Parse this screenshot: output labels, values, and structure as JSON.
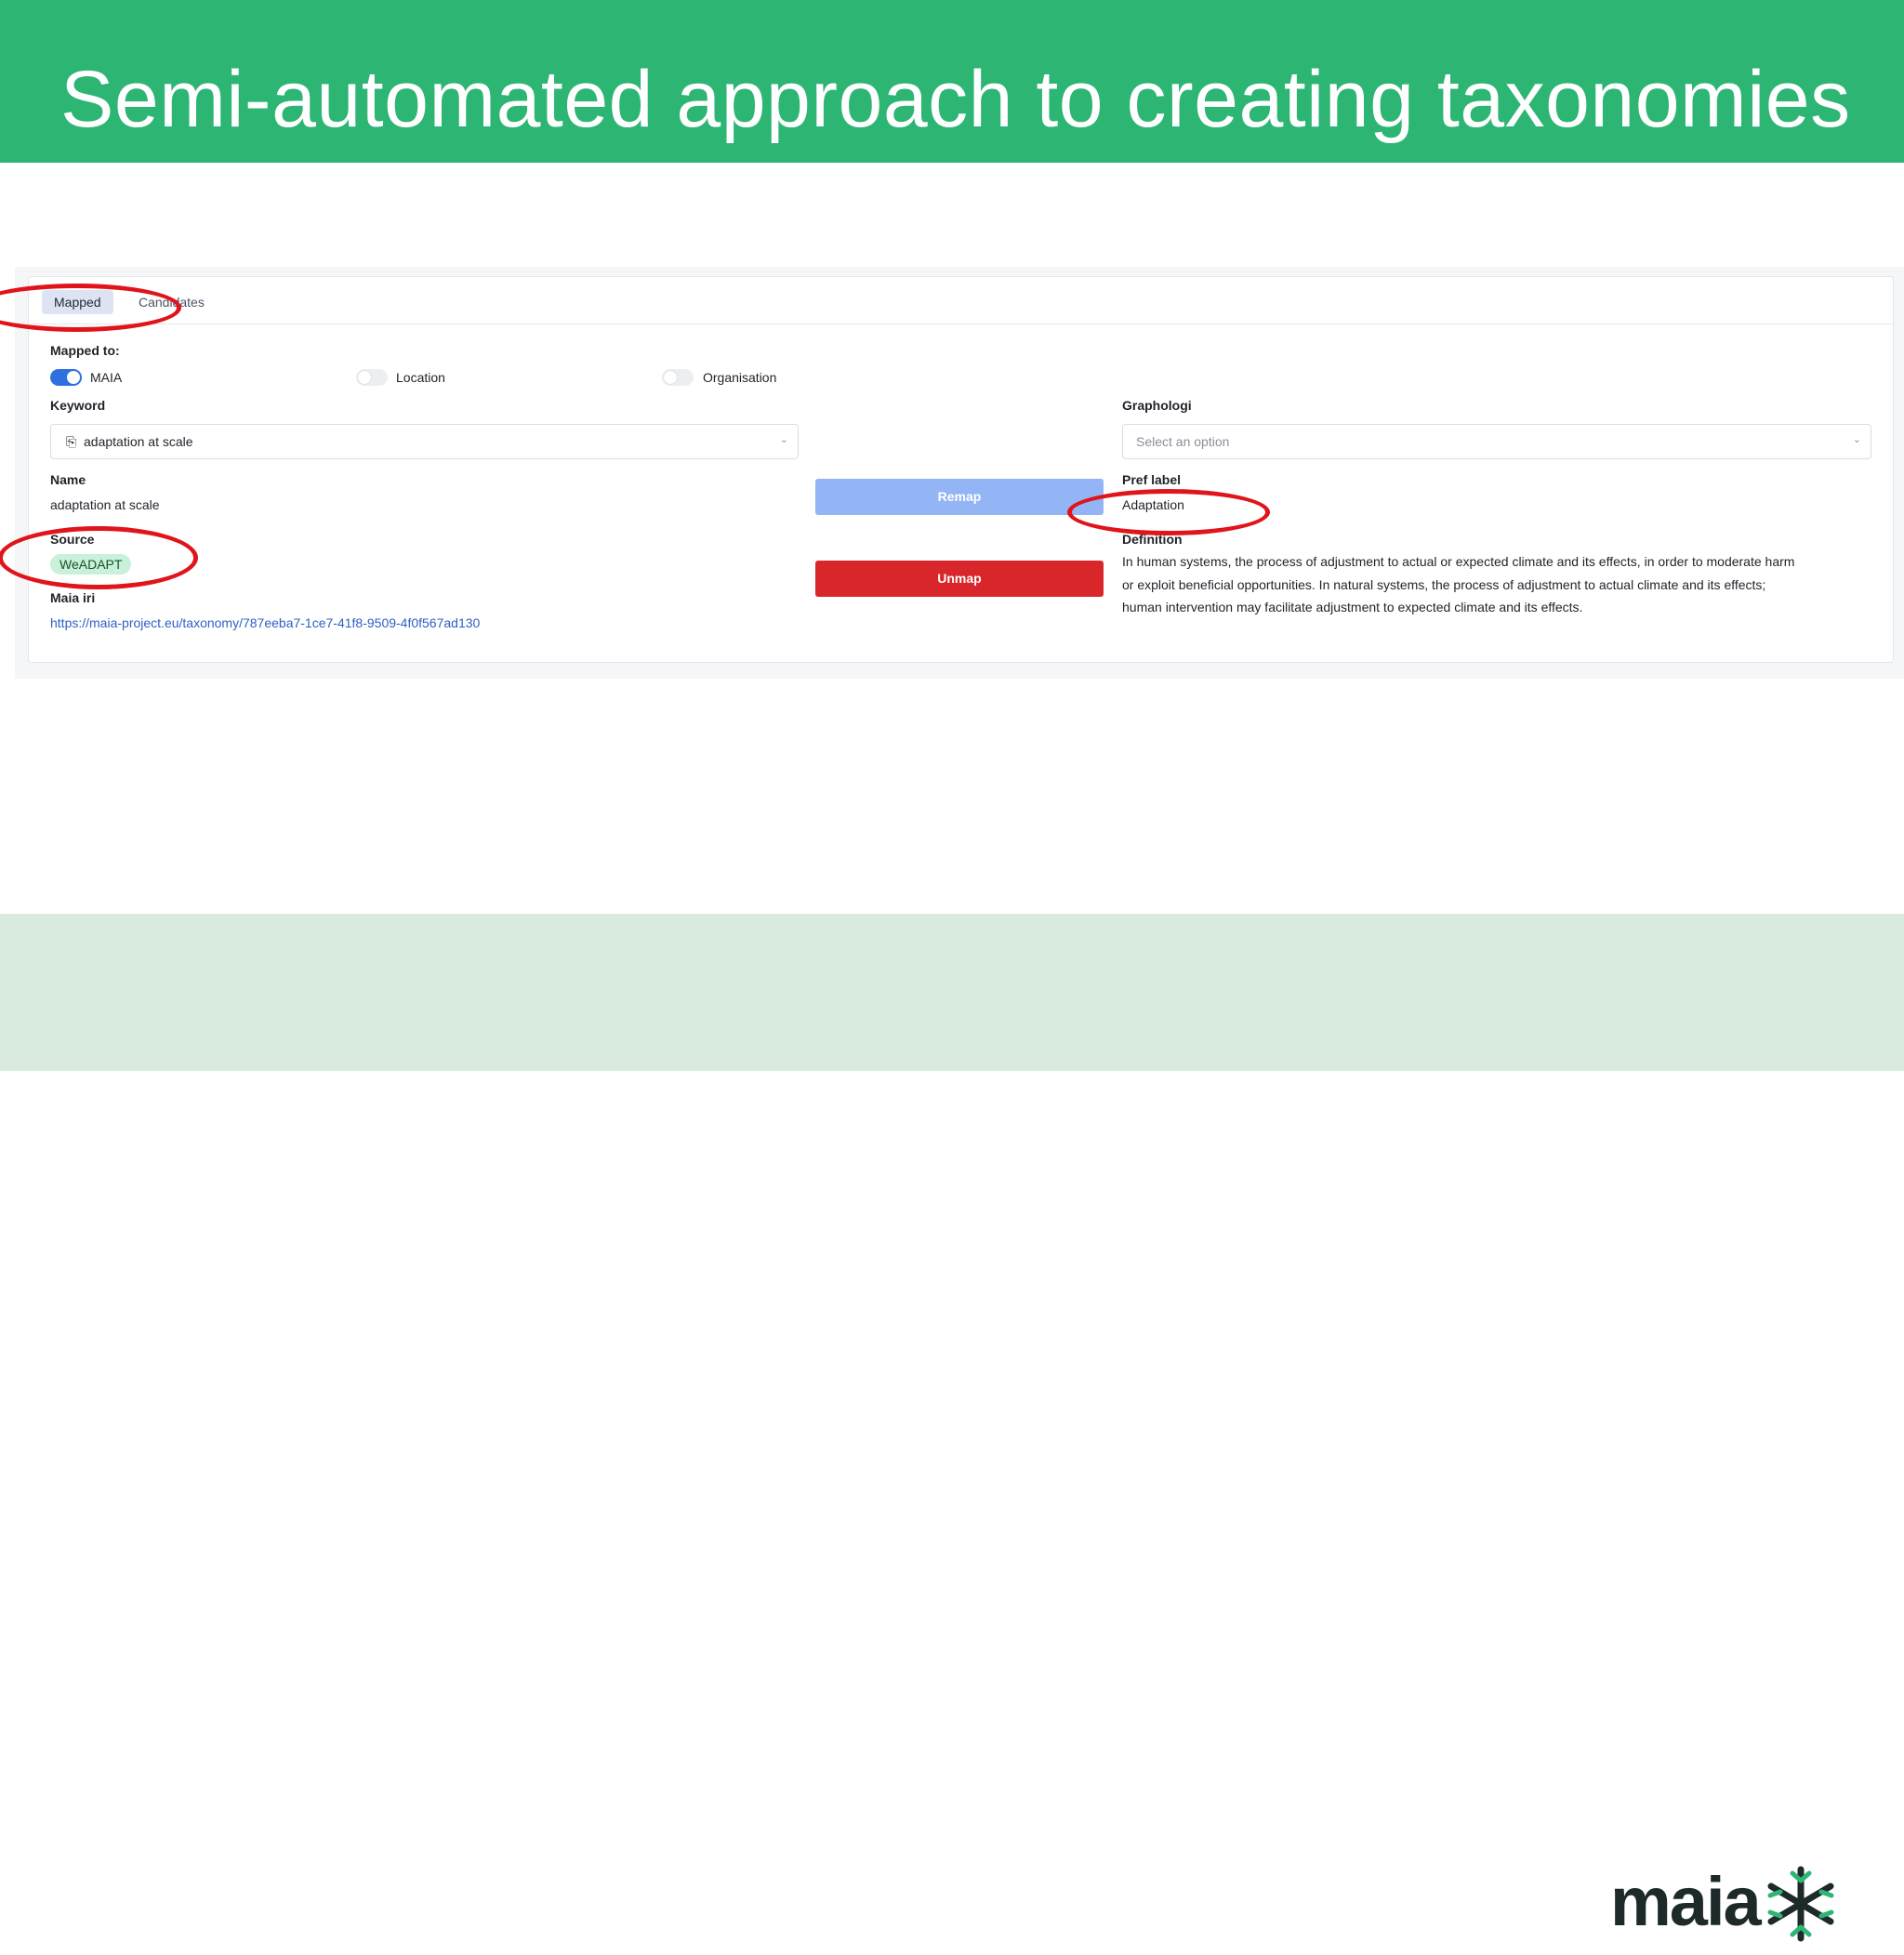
{
  "slide": {
    "title": "Semi-automated approach to creating taxonomies"
  },
  "tabs": [
    {
      "label": "Mapped",
      "active": true
    },
    {
      "label": "Candidates",
      "active": false
    }
  ],
  "mapped_to": {
    "label": "Mapped to:",
    "toggles": [
      {
        "label": "MAIA",
        "on": true
      },
      {
        "label": "Location",
        "on": false
      },
      {
        "label": "Organisation",
        "on": false
      }
    ]
  },
  "keyword": {
    "label": "Keyword",
    "value": "adaptation at scale"
  },
  "graphologi": {
    "label": "Graphologi",
    "placeholder": "Select an option"
  },
  "name": {
    "label": "Name",
    "value": "adaptation at scale"
  },
  "source": {
    "label": "Source",
    "value": "WeADAPT"
  },
  "maia_iri": {
    "label": "Maia iri",
    "value": "https://maia-project.eu/taxonomy/787eeba7-1ce7-41f8-9509-4f0f567ad130"
  },
  "buttons": {
    "remap": "Remap",
    "unmap": "Unmap"
  },
  "pref_label": {
    "label": "Pref label",
    "value": "Adaptation"
  },
  "definition": {
    "label": "Definition",
    "line1": "In human systems, the process of adjustment to actual or expected climate and its effects, in order to moderate harm",
    "line2": "or exploit beneficial opportunities. In natural systems, the process of adjustment to actual climate and its effects;",
    "line3": "human intervention may facilitate adjustment to expected climate and its effects."
  },
  "logo": {
    "text": "maia"
  },
  "colors": {
    "header_green": "#2db574",
    "footer_green": "#d9ebdf",
    "highlight_red": "#e0141a",
    "toggle_blue": "#2f6fe0",
    "remap_blue": "#93b4f5",
    "unmap_red": "#d9262b"
  }
}
